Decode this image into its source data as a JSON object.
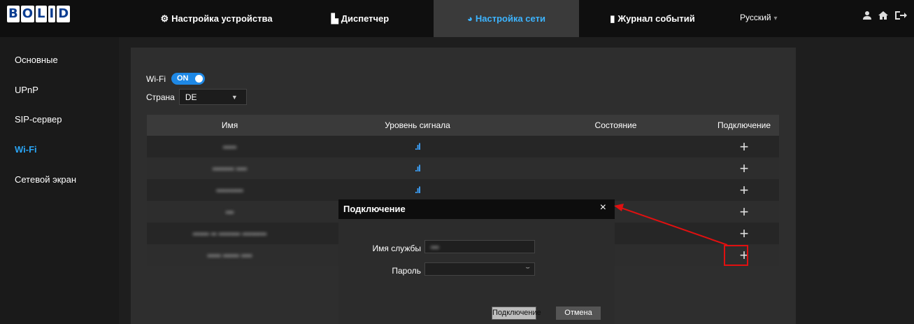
{
  "header": {
    "logo": [
      "B",
      "O",
      "L",
      "I",
      "D"
    ],
    "nav": [
      {
        "label": "Настройка устройства",
        "icon": "gear-icon",
        "glyph": "⚙"
      },
      {
        "label": "Диспетчер",
        "icon": "buildings-icon",
        "glyph": "▙"
      },
      {
        "label": "Настройка сети",
        "icon": "globe-icon",
        "glyph": "◕"
      },
      {
        "label": "Журнал событий",
        "icon": "log-icon",
        "glyph": "▮"
      }
    ],
    "language": "Русский",
    "icons": {
      "user": "user-icon",
      "home": "home-icon",
      "logout": "logout-icon"
    }
  },
  "sidebar": {
    "items": [
      "Основные",
      "UPnP",
      "SIP-сервер",
      "Wi-Fi",
      "Сетевой экран"
    ],
    "active_index": 3
  },
  "wifi": {
    "label": "Wi-Fi",
    "toggle": "ON",
    "country_label": "Страна",
    "country_value": "DE"
  },
  "table": {
    "headers": [
      "Имя",
      "Уровень сигнала",
      "Состояние",
      "Подключение"
    ],
    "rows": [
      {
        "name": "•••••",
        "signal": "📶",
        "state": "",
        "connect": "+"
      },
      {
        "name": "•••••••• ••••",
        "signal": "📶",
        "state": "",
        "connect": "+"
      },
      {
        "name": "••••••••••",
        "signal": "📶",
        "state": "",
        "connect": "+"
      },
      {
        "name": "•••",
        "signal": "",
        "state": "",
        "connect": "+"
      },
      {
        "name": "•••••• •• •••••••• •••••••••",
        "signal": "",
        "state": "",
        "connect": "+"
      },
      {
        "name": "••••• •••••• ••••",
        "signal": "",
        "state": "",
        "connect": "+"
      }
    ]
  },
  "dialog": {
    "title": "Подключение",
    "close": "×",
    "service_label": "Имя службы",
    "service_value": "•••",
    "password_label": "Пароль",
    "connect_button": "Подключение",
    "cancel_button": "Отмена"
  },
  "colors": {
    "accent": "#2aa4f4",
    "annotation": "#e01010"
  }
}
